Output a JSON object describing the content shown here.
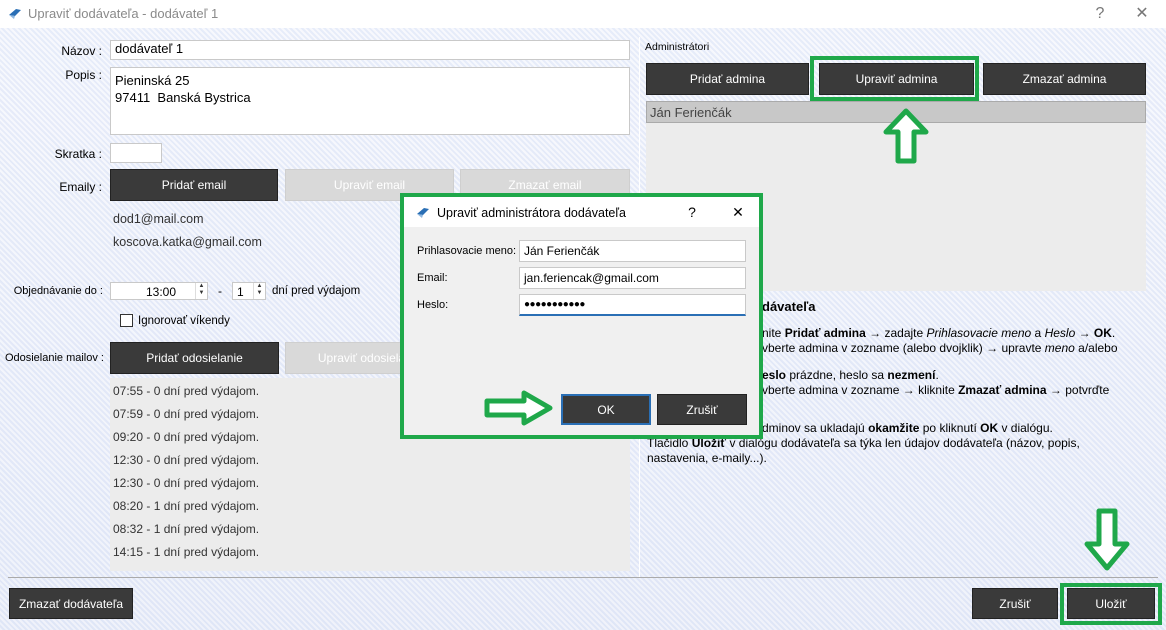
{
  "window": {
    "title": "Upraviť dodávateľa - dodávateľ 1",
    "help_glyph": "?",
    "close_glyph": "✕"
  },
  "form": {
    "name_label": "Názov :",
    "name_value": "dodávateľ 1",
    "desc_label": "Popis :",
    "desc_line1": "Pieninská 25",
    "desc_line2": "97411  Banská Bystrica",
    "short_label": "Skratka :",
    "short_value": "",
    "emails_label": "Emaily :",
    "add_email": "Pridať email",
    "edit_email": "Upraviť email",
    "delete_email": "Zmazať email",
    "emails": [
      "dod1@mail.com",
      "koscova.katka@gmail.com"
    ],
    "order_label": "Objednávanie do :",
    "order_time": "13:00",
    "dash": "-",
    "order_days": "1",
    "order_suffix": "dní pred výdajom",
    "ignore_weekends": "Ignorovať víkendy",
    "mail_label": "Odosielanie mailov :",
    "add_sender": "Pridať odosielanie",
    "edit_sender": "Upraviť odosielanie",
    "senders": [
      "07:55 - 0 dní pred výdajom.",
      "07:59 - 0 dní pred výdajom.",
      "09:20 - 0 dní pred výdajom.",
      "12:30 - 0 dní pred výdajom.",
      "12:30 - 0 dní pred výdajom.",
      "08:20 - 1 dní pred výdajom.",
      "08:32 - 1 dní pred výdajom.",
      "14:15 - 1 dní pred výdajom."
    ]
  },
  "admins": {
    "group_label": "Administrátori",
    "add": "Pridať admina",
    "edit": "Upraviť admina",
    "delete": "Zmazať admina",
    "items": [
      "Ján Ferienčák"
    ]
  },
  "help": {
    "heading_tail": "dávateľa",
    "p1a_pre": "nite ",
    "p1a_b1": "Pridať admina",
    "p1a_mid": " → zadajte ",
    "p1a_i1": "Prihlasovacie meno",
    "p1a_a": " a ",
    "p1a_i2": "Heslo",
    "p1a_arrow": " → ",
    "p1a_b2": "OK",
    "p1a_end": ".",
    "p1b_pre": "vberte admina v zozname (alebo dvojklik) → upravte ",
    "p1b_i": "meno",
    "p1b_end": " a/alebo",
    "p2a_b": "eslo",
    "p2a_mid": " prázdne, heslo sa ",
    "p2a_b2": "nezmení",
    "p2a_end": ".",
    "p2b_pre": "vberte admina v zozname → kliknite ",
    "p2b_b": "Zmazať admina",
    "p2b_end": " → potvrďte",
    "p3a_pre": "dminov sa ukladajú ",
    "p3a_b": "okamžite",
    "p3a_mid": " po kliknutí ",
    "p3a_b2": "OK",
    "p3a_end": " v dialógu.",
    "p3b_pre": "Tlačidlo ",
    "p3b_b": "Uložiť",
    "p3b_end": " v dialógu dodávateľa sa týka len údajov dodávateľa (názov, popis,",
    "p3c": "nastavenia, e-maily...)."
  },
  "footer": {
    "delete_supplier": "Zmazať dodávateľa",
    "cancel": "Zrušiť",
    "save": "Uložiť"
  },
  "dialog": {
    "title": "Upraviť administrátora dodávateľa",
    "help_glyph": "?",
    "close_glyph": "✕",
    "login_label": "Prihlasovacie meno:",
    "login_value": "Ján Ferienčák",
    "email_label": "Email:",
    "email_value": "jan.feriencak@gmail.com",
    "password_label": "Heslo:",
    "password_value": "●●●●●●●●●●●",
    "ok": "OK",
    "cancel": "Zrušiť"
  },
  "colors": {
    "highlight": "#1fa84a",
    "button_dark": "#3a3a3a"
  }
}
